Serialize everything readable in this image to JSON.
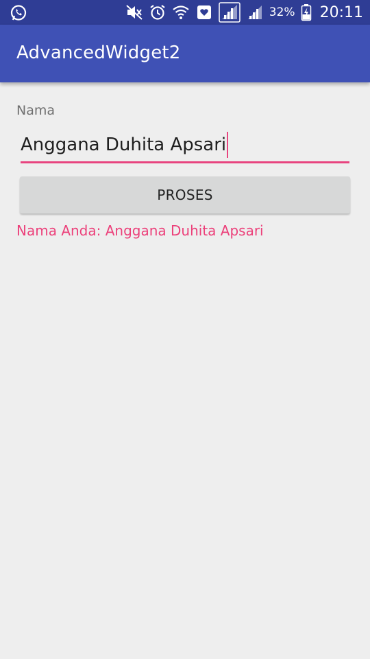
{
  "status_bar": {
    "battery_percent": "32%",
    "time": "20:11",
    "icons": [
      "whatsapp-icon",
      "mute-icon",
      "alarm-icon",
      "wifi-icon",
      "health-icon",
      "signal-icon",
      "signal-icon-2",
      "battery-icon"
    ]
  },
  "app_bar": {
    "title": "AdvancedWidget2",
    "color": "#3f51b5"
  },
  "form": {
    "label": "Nama",
    "input_value": "Anggana Duhita Apsari",
    "button_label": "PROSES",
    "result_text": "Nama Anda: Anggana Duhita Apsari",
    "accent_color": "#ec407a"
  }
}
